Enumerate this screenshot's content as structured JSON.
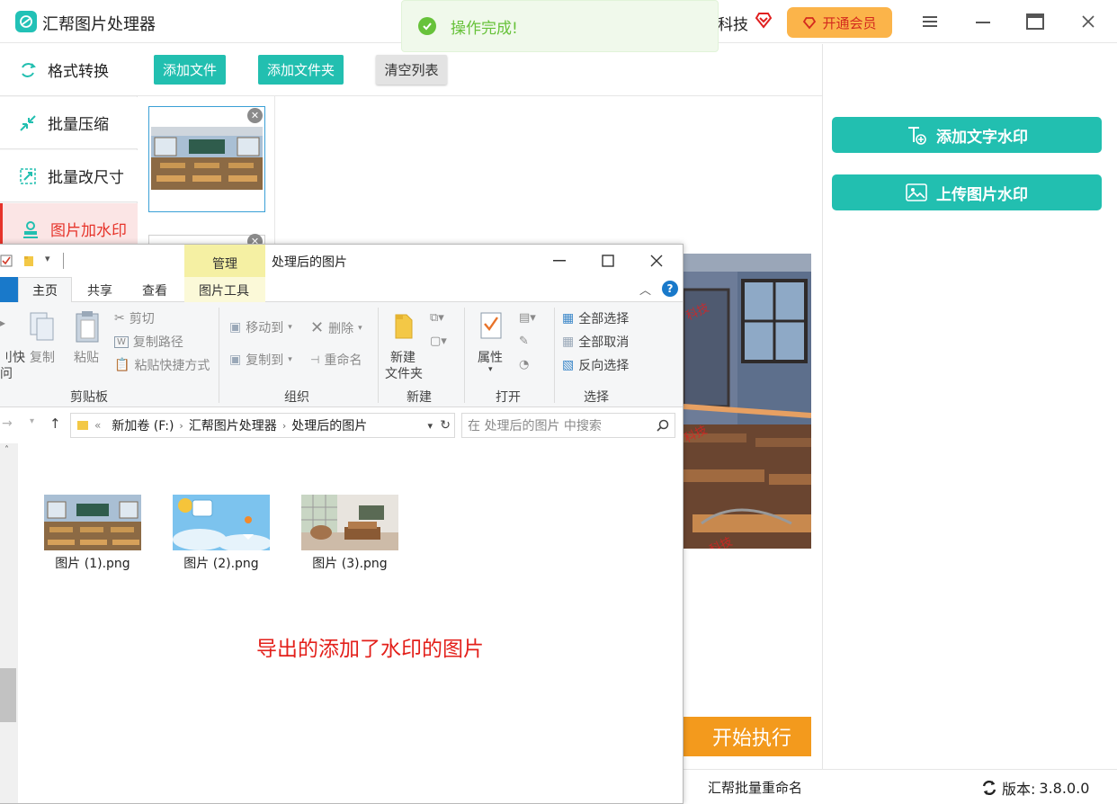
{
  "app": {
    "title": "汇帮图片处理器",
    "brand_text": "科技",
    "vip_label": "开通会员"
  },
  "toast": {
    "message": "操作完成!"
  },
  "nav": {
    "items": [
      {
        "label": "格式转换"
      },
      {
        "label": "批量压缩"
      },
      {
        "label": "批量改尺寸"
      },
      {
        "label": "图片加水印"
      }
    ]
  },
  "toolbar": {
    "add_file": "添加文件",
    "add_folder": "添加文件夹",
    "clear_list": "清空列表"
  },
  "watermark": {
    "add_text": "添加文字水印",
    "upload_image": "上传图片水印"
  },
  "start_label": "开始执行",
  "footer": {
    "promo": "汇帮批量重命名",
    "version_label": "版本:",
    "version": "3.8.0.0"
  },
  "explorer": {
    "context_tab": "管理",
    "title": "处理后的图片",
    "tabs": {
      "home": "主页",
      "share": "共享",
      "view": "查看",
      "picture_tools": "图片工具"
    },
    "ribbon": {
      "quick_access_1": "刂快",
      "quick_access_2": "问",
      "copy": "复制",
      "paste": "粘贴",
      "cut": "剪切",
      "copy_path": "复制路径",
      "paste_shortcut": "粘贴快捷方式",
      "clipboard_group": "剪贴板",
      "move_to": "移动到",
      "copy_to": "复制到",
      "delete": "删除",
      "rename": "重命名",
      "organize_group": "组织",
      "new_folder_1": "新建",
      "new_folder_2": "文件夹",
      "new_group": "新建",
      "properties": "属性",
      "open_group": "打开",
      "select_all": "全部选择",
      "select_none": "全部取消",
      "invert_selection": "反向选择",
      "select_group": "选择"
    },
    "address": {
      "separator": "«",
      "crumbs": [
        "新加卷 (F:)",
        "汇帮图片处理器",
        "处理后的图片"
      ]
    },
    "search_placeholder": "在 处理后的图片 中搜索",
    "files": [
      {
        "name": "图片 (1).png"
      },
      {
        "name": "图片 (2).png"
      },
      {
        "name": "图片 (3).png"
      }
    ],
    "annotation": "导出的添加了水印的图片"
  },
  "colors": {
    "teal": "#22bfb0",
    "orange": "#f39a1d",
    "vip": "#fbb44a",
    "active_nav": "#e6332a",
    "toast_green": "#67c23a",
    "annotation_red": "#e3201b"
  }
}
